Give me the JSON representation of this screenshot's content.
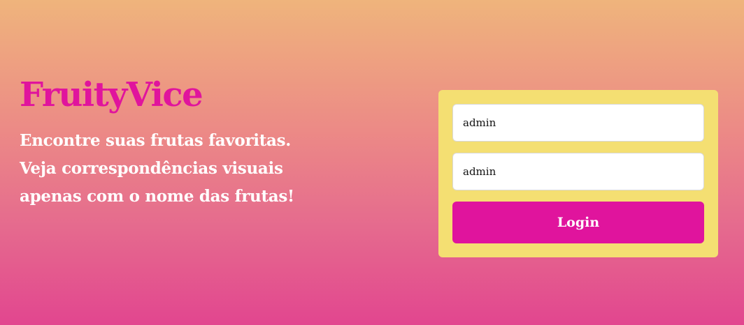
{
  "brand": {
    "name": "FruityVice"
  },
  "hero": {
    "tagline_lines": [
      "Encontre suas frutas favoritas.",
      "Veja correspondências visuais",
      "apenas com o nome das frutas!"
    ]
  },
  "login": {
    "username_value": "admin",
    "password_value": "admin",
    "submit_label": "Login"
  },
  "colors": {
    "brand": "#e0149d",
    "card_background": "#f4df72",
    "gradient_top": "#efb47c",
    "gradient_bottom": "#e2468f"
  }
}
